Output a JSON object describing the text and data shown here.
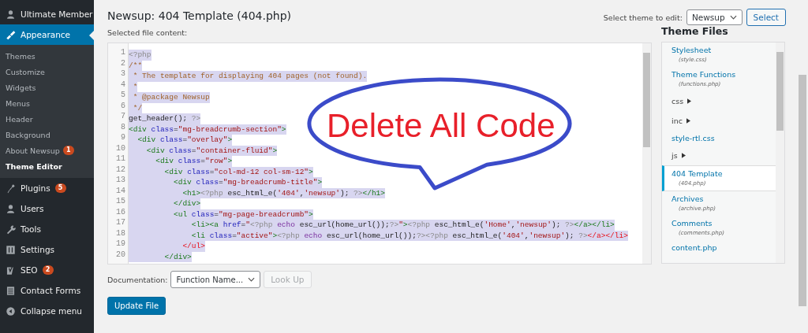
{
  "sidebar": {
    "items": [
      {
        "label": "Ultimate Member",
        "selected": false
      },
      {
        "label": "Appearance",
        "selected": true,
        "children": [
          {
            "label": "Themes",
            "current": false
          },
          {
            "label": "Customize",
            "current": false
          },
          {
            "label": "Widgets",
            "current": false
          },
          {
            "label": "Menus",
            "current": false
          },
          {
            "label": "Header",
            "current": false
          },
          {
            "label": "Background",
            "current": false
          },
          {
            "label": "About Newsup",
            "current": false,
            "badge": "1"
          },
          {
            "label": "Theme Editor",
            "current": true
          }
        ]
      },
      {
        "label": "Plugins",
        "selected": false,
        "badge": "5"
      },
      {
        "label": "Users",
        "selected": false
      },
      {
        "label": "Tools",
        "selected": false
      },
      {
        "label": "Settings",
        "selected": false
      },
      {
        "label": "SEO",
        "selected": false,
        "badge": "2"
      },
      {
        "label": "Contact Forms",
        "selected": false
      },
      {
        "label": "Collapse menu",
        "selected": false
      }
    ]
  },
  "page": {
    "title": "Newsup: 404 Template (404.php)",
    "content_label": "Selected file content:",
    "theme_select_label": "Select theme to edit:",
    "theme_select_value": "Newsup",
    "select_button": "Select"
  },
  "editor": {
    "all_selected": true,
    "lines": [
      {
        "number": "1",
        "tokens": [
          {
            "kind": "php",
            "text": "<?php"
          }
        ]
      },
      {
        "number": "2",
        "tokens": [
          {
            "kind": "comment",
            "text": "/**"
          }
        ]
      },
      {
        "number": "3",
        "tokens": [
          {
            "kind": "comment",
            "text": " * The template for displaying 404 pages (not found)."
          }
        ]
      },
      {
        "number": "4",
        "tokens": [
          {
            "kind": "comment",
            "text": " *"
          }
        ]
      },
      {
        "number": "5",
        "tokens": [
          {
            "kind": "comment",
            "text": " * @package Newsup"
          }
        ]
      },
      {
        "number": "6",
        "tokens": [
          {
            "kind": "comment",
            "text": " */"
          }
        ]
      },
      {
        "number": "7",
        "tokens": [
          {
            "kind": "plain",
            "text": "get_header(); "
          },
          {
            "kind": "php",
            "text": "?>"
          }
        ]
      },
      {
        "number": "8",
        "tokens": [
          {
            "kind": "tag",
            "text": "<div "
          },
          {
            "kind": "attr",
            "text": "class"
          },
          {
            "kind": "plain",
            "text": "="
          },
          {
            "kind": "string",
            "text": "\"mg-breadcrumb-section\""
          },
          {
            "kind": "tag",
            "text": ">"
          }
        ]
      },
      {
        "number": "9",
        "tokens": [
          {
            "kind": "tag",
            "text": "  <div "
          },
          {
            "kind": "attr",
            "text": "class"
          },
          {
            "kind": "plain",
            "text": "="
          },
          {
            "kind": "string",
            "text": "\"overlay\""
          },
          {
            "kind": "tag",
            "text": ">"
          }
        ]
      },
      {
        "number": "10",
        "tokens": [
          {
            "kind": "tag",
            "text": "    <div "
          },
          {
            "kind": "attr",
            "text": "class"
          },
          {
            "kind": "plain",
            "text": "="
          },
          {
            "kind": "string",
            "text": "\"container-fluid\""
          },
          {
            "kind": "tag",
            "text": ">"
          }
        ]
      },
      {
        "number": "11",
        "tokens": [
          {
            "kind": "tag",
            "text": "      <div "
          },
          {
            "kind": "attr",
            "text": "class"
          },
          {
            "kind": "plain",
            "text": "="
          },
          {
            "kind": "string",
            "text": "\"row\""
          },
          {
            "kind": "tag",
            "text": ">"
          }
        ]
      },
      {
        "number": "12",
        "tokens": [
          {
            "kind": "tag",
            "text": "        <div "
          },
          {
            "kind": "attr",
            "text": "class"
          },
          {
            "kind": "plain",
            "text": "="
          },
          {
            "kind": "string",
            "text": "\"col-md-12 col-sm-12\""
          },
          {
            "kind": "tag",
            "text": ">"
          }
        ]
      },
      {
        "number": "13",
        "tokens": [
          {
            "kind": "tag",
            "text": "          <div "
          },
          {
            "kind": "attr",
            "text": "class"
          },
          {
            "kind": "plain",
            "text": "="
          },
          {
            "kind": "string",
            "text": "\"mg-breadcrumb-title\""
          },
          {
            "kind": "tag",
            "text": ">"
          }
        ]
      },
      {
        "number": "14",
        "tokens": [
          {
            "kind": "tag",
            "text": "            <h1>"
          },
          {
            "kind": "php",
            "text": "<?php "
          },
          {
            "kind": "plain",
            "text": "esc_html_e("
          },
          {
            "kind": "string",
            "text": "'404'"
          },
          {
            "kind": "plain",
            "text": ","
          },
          {
            "kind": "string",
            "text": "'newsup'"
          },
          {
            "kind": "plain",
            "text": "); "
          },
          {
            "kind": "php",
            "text": "?>"
          },
          {
            "kind": "tag",
            "text": "</h1>"
          }
        ]
      },
      {
        "number": "15",
        "tokens": [
          {
            "kind": "tag",
            "text": "          </div>"
          }
        ]
      },
      {
        "number": "16",
        "tokens": [
          {
            "kind": "tag",
            "text": "          <ul "
          },
          {
            "kind": "attr",
            "text": "class"
          },
          {
            "kind": "plain",
            "text": "="
          },
          {
            "kind": "string",
            "text": "\"mg-page-breadcrumb\""
          },
          {
            "kind": "tag",
            "text": ">"
          }
        ]
      },
      {
        "number": "17",
        "tokens": [
          {
            "kind": "tag",
            "text": "              <li><a "
          },
          {
            "kind": "attr",
            "text": "href"
          },
          {
            "kind": "plain",
            "text": "="
          },
          {
            "kind": "string",
            "text": "\""
          },
          {
            "kind": "php",
            "text": "<?php "
          },
          {
            "kind": "keyword",
            "text": "echo "
          },
          {
            "kind": "plain",
            "text": "esc_url(home_url());"
          },
          {
            "kind": "php",
            "text": "?>"
          },
          {
            "kind": "string",
            "text": "\""
          },
          {
            "kind": "tag",
            "text": ">"
          },
          {
            "kind": "php",
            "text": "<?php "
          },
          {
            "kind": "plain",
            "text": "esc_html_e("
          },
          {
            "kind": "string",
            "text": "'Home'"
          },
          {
            "kind": "plain",
            "text": ","
          },
          {
            "kind": "string",
            "text": "'newsup'"
          },
          {
            "kind": "plain",
            "text": "); "
          },
          {
            "kind": "php",
            "text": "?>"
          },
          {
            "kind": "tag",
            "text": "</a></li>"
          }
        ]
      },
      {
        "number": "18",
        "tokens": [
          {
            "kind": "tag",
            "text": "              <li "
          },
          {
            "kind": "attr",
            "text": "class"
          },
          {
            "kind": "plain",
            "text": "="
          },
          {
            "kind": "string",
            "text": "\"active\""
          },
          {
            "kind": "tag",
            "text": ">"
          },
          {
            "kind": "php",
            "text": "<?php "
          },
          {
            "kind": "keyword",
            "text": "echo "
          },
          {
            "kind": "plain",
            "text": "esc_url(home_url());"
          },
          {
            "kind": "php",
            "text": "?><?php "
          },
          {
            "kind": "plain",
            "text": "esc_html_e("
          },
          {
            "kind": "string",
            "text": "'404'"
          },
          {
            "kind": "plain",
            "text": ","
          },
          {
            "kind": "string",
            "text": "'newsup'"
          },
          {
            "kind": "plain",
            "text": "); "
          },
          {
            "kind": "php",
            "text": "?>"
          },
          {
            "kind": "error",
            "text": "</a></li>"
          }
        ]
      },
      {
        "number": "19",
        "tokens": [
          {
            "kind": "error",
            "text": "            </ul>"
          }
        ]
      },
      {
        "number": "20",
        "tokens": [
          {
            "kind": "tag",
            "text": "        </div>"
          }
        ]
      }
    ]
  },
  "callout": {
    "text": "Delete All Code"
  },
  "documentation": {
    "label": "Documentation:",
    "placeholder": "Function Name...",
    "lookup_button": "Look Up",
    "lookup_disabled": true
  },
  "update_button": "Update File",
  "theme_files": {
    "title": "Theme Files",
    "items": [
      {
        "kind": "file",
        "label": "Stylesheet",
        "sub": "(style.css)",
        "selected": false
      },
      {
        "kind": "file",
        "label": "Theme Functions",
        "sub": "(functions.php)",
        "selected": false
      },
      {
        "kind": "folder",
        "label": "css",
        "selected": false
      },
      {
        "kind": "folder",
        "label": "inc",
        "selected": false
      },
      {
        "kind": "file",
        "label": "style-rtl.css",
        "selected": false
      },
      {
        "kind": "folder",
        "label": "js",
        "selected": false
      },
      {
        "kind": "file",
        "label": "404 Template",
        "sub": "(404.php)",
        "selected": true
      },
      {
        "kind": "file",
        "label": "Archives",
        "sub": "(archive.php)",
        "selected": false
      },
      {
        "kind": "file",
        "label": "Comments",
        "sub": "(comments.php)",
        "selected": false
      },
      {
        "kind": "file",
        "label": "content.php",
        "selected": false
      }
    ]
  }
}
